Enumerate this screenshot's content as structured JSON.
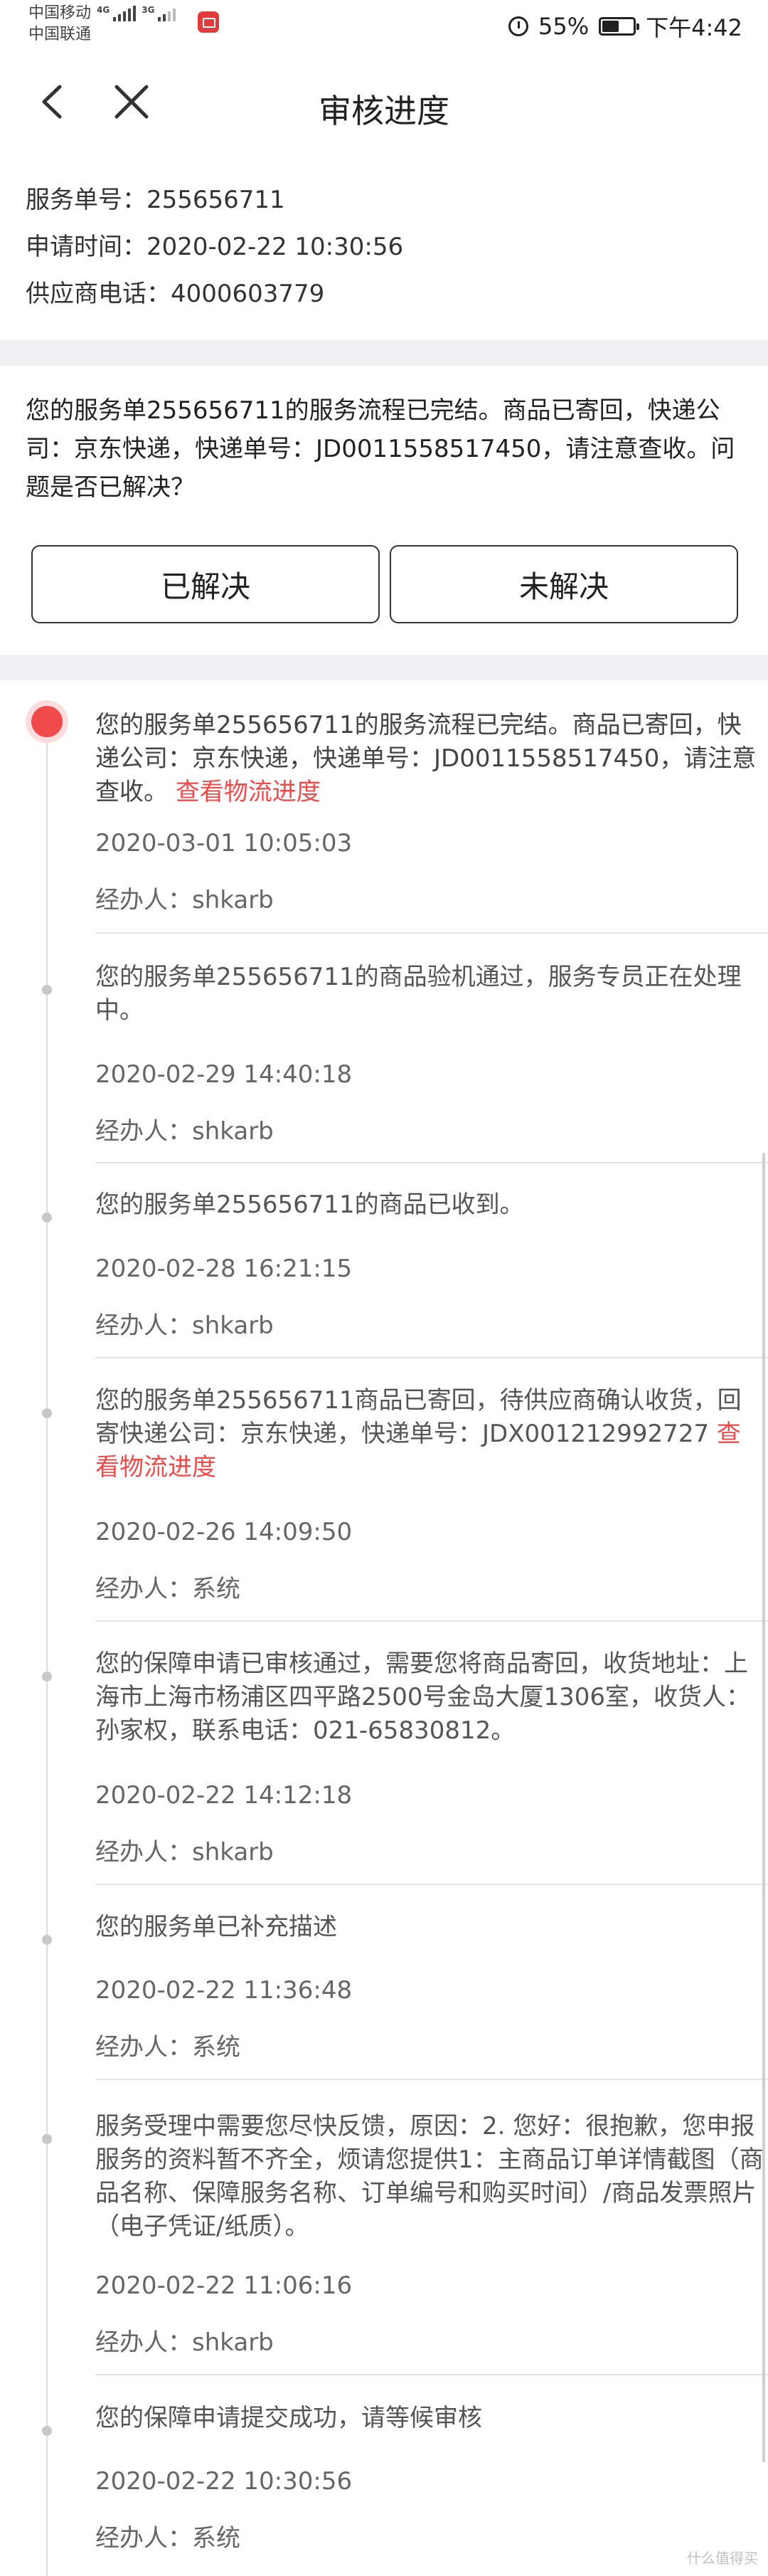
{
  "status_bar": {
    "carrier1": "中国移动",
    "carrier2": "中国联通",
    "net1": "4G",
    "net2": "3G",
    "battery_percent": "55%",
    "battery_level": 0.55,
    "time": "下午4:42"
  },
  "header": {
    "title": "审核进度"
  },
  "info": {
    "service_no": "服务单号：255656711",
    "apply_time": "申请时间：2020-02-22 10:30:56",
    "supplier_phone": "供应商电话：4000603779"
  },
  "notice": {
    "text": "您的服务单255656711的服务流程已完结。商品已寄回，快递公司：京东快递，快递单号：JD0011558517450，请注意查收。问题是否已解决？",
    "resolved_label": "已解决",
    "unresolved_label": "未解决"
  },
  "timeline": [
    {
      "text": "您的服务单255656711的服务流程已完结。商品已寄回，快递公司：京东快递，快递单号：JD0011558517450，请注意查收。",
      "link": "查看物流进度",
      "time": "2020-03-01 10:05:03",
      "handler": "经办人：shkarb"
    },
    {
      "text": "您的服务单255656711的商品验机通过，服务专员正在处理中。",
      "link": "",
      "time": "2020-02-29 14:40:18",
      "handler": "经办人：shkarb"
    },
    {
      "text": "您的服务单255656711的商品已收到。",
      "link": "",
      "time": "2020-02-28 16:21:15",
      "handler": "经办人：shkarb"
    },
    {
      "text": "您的服务单255656711商品已寄回，待供应商确认收货，回寄快递公司：京东快递，快递单号：JDX001212992727 ",
      "link": "查看物流进度",
      "time": "2020-02-26 14:09:50",
      "handler": "经办人：系统"
    },
    {
      "text": "您的保障申请已审核通过，需要您将商品寄回，收货地址：上海市上海市杨浦区四平路2500号金岛大厦1306室，收货人： 孙家权，联系电话：021-65830812。",
      "link": "",
      "time": "2020-02-22 14:12:18",
      "handler": "经办人：shkarb"
    },
    {
      "text": "您的服务单已补充描述",
      "link": "",
      "time": "2020-02-22 11:36:48",
      "handler": "经办人：系统"
    },
    {
      "text": "服务受理中需要您尽快反馈，原因：2. 您好：很抱歉，您申报服务的资料暂不齐全，烦请您提供1：主商品订单详情截图（商品名称、保障服务名称、订单编号和购买时间）/商品发票照片（电子凭证/纸质）。",
      "link": "",
      "time": "2020-02-22 11:06:16",
      "handler": "经办人：shkarb"
    },
    {
      "text": "您的保障申请提交成功，请等候审核",
      "link": "",
      "time": "2020-02-22 10:30:56",
      "handler": "经办人：系统"
    }
  ],
  "watermark": "什么值得买"
}
